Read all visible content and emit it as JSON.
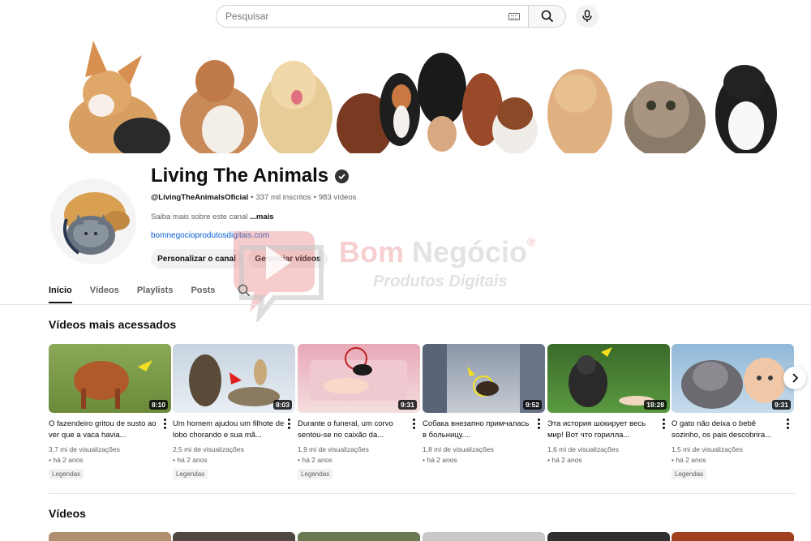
{
  "search": {
    "placeholder": "Pesquisar"
  },
  "channel": {
    "name": "Living The Animals",
    "handle": "@LivingTheAnimalsOficial",
    "separator": "•",
    "subscribers": "337 mil inscritos",
    "videos": "983 vídeos",
    "about": "Saiba mais sobre este canal",
    "about_more": "...mais",
    "link": "bomnegocioprodutosdigitais.com"
  },
  "buttons": {
    "customize": "Personalizar o canal",
    "manage": "Gerenciar vídeos"
  },
  "tabs": [
    {
      "label": "Início",
      "active": true
    },
    {
      "label": "Vídeos",
      "active": false
    },
    {
      "label": "Playlists",
      "active": false
    },
    {
      "label": "Posts",
      "active": false
    }
  ],
  "watermark": {
    "line1a": "Bom",
    "line1b": "Negócio",
    "reg": "®",
    "line2": "Produtos Digitais"
  },
  "sections": {
    "popular": "Vídeos mais acessados",
    "videos": "Vídeos"
  },
  "videos": [
    {
      "title": "O fazendeiro gritou de susto ao ver que a vaca havia...",
      "duration": "8:10",
      "views": "3,7 mi de visualizações",
      "age": "• há 2 anos",
      "badge": "Legendas",
      "colors": [
        "#6b8a3a",
        "#b05a2a"
      ]
    },
    {
      "title": "Um homem ajudou um filhote de lobo chorando e sua mã...",
      "duration": "8:03",
      "views": "2,5 mi de visualizações",
      "age": "• há 2 anos",
      "badge": "Legendas",
      "colors": [
        "#dfe6ee",
        "#6b5a40"
      ]
    },
    {
      "title": "Durante o funeral, um corvo sentou-se no caixão da...",
      "duration": "9:31",
      "views": "1,9 mi de visualizações",
      "age": "• há 2 anos",
      "badge": "Legendas",
      "colors": [
        "#e8b0bc",
        "#f4dede"
      ]
    },
    {
      "title": "Собака внезапно примчалась в больницу....",
      "duration": "9:52",
      "views": "1,8 mi de visualizações",
      "age": "• há 2 anos",
      "badge": "",
      "colors": [
        "#9aa6b8",
        "#5a6478"
      ]
    },
    {
      "title": "Эта история шокирует весь мир! Вот что горилла...",
      "duration": "18:28",
      "views": "1,6 mi de visualizações",
      "age": "• há 2 anos",
      "badge": "",
      "colors": [
        "#4f8a3a",
        "#2c2c2c"
      ]
    },
    {
      "title": "O gato não deixa o bebê sozinho, os pais descobrira...",
      "duration": "9:31",
      "views": "1,5 mi de visualizações",
      "age": "• há 2 anos",
      "badge": "Legendas",
      "colors": [
        "#8fb8d8",
        "#e8c8a8"
      ]
    }
  ],
  "bottom_thumbs": [
    "#b09070",
    "#504840",
    "#6a7a50",
    "#c8c8c8",
    "#303030",
    "#a04020"
  ]
}
